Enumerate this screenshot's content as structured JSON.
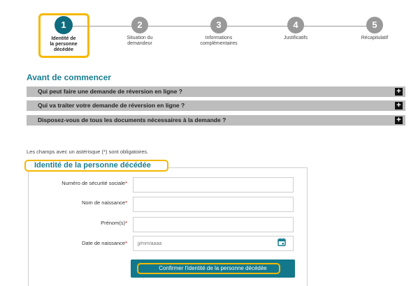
{
  "stepper": {
    "steps": [
      {
        "number": "1",
        "label_lines": [
          "Identité de",
          "la personne",
          "décédée"
        ],
        "active": true
      },
      {
        "number": "2",
        "label_lines": [
          "Situation du",
          "demandeur"
        ],
        "active": false
      },
      {
        "number": "3",
        "label_lines": [
          "Informations",
          "complémentaires"
        ],
        "active": false
      },
      {
        "number": "4",
        "label_lines": [
          "Justificatifs"
        ],
        "active": false
      },
      {
        "number": "5",
        "label_lines": [
          "Récapitulatif"
        ],
        "active": false
      }
    ]
  },
  "intro": {
    "title": "Avant de commencer",
    "accordions": [
      {
        "label": "Qui peut faire une demande de réversion en ligne ?",
        "icon": "plus-icon"
      },
      {
        "label": "Qui va traiter votre demande de réversion en ligne ?",
        "icon": "plus-icon"
      },
      {
        "label": "Disposez-vous de tous les documents nécessaires à la demande ?",
        "icon": "plus-icon"
      }
    ]
  },
  "form": {
    "required_note": "Les champs avec un astérisque (*) sont obligatoires.",
    "legend": "Identité de la personne décédée",
    "fields": [
      {
        "label": "Numéro de sécurité sociale",
        "required_mark": "*",
        "value": "",
        "placeholder": ""
      },
      {
        "label": "Nom de naissance",
        "required_mark": "*",
        "value": "",
        "placeholder": ""
      },
      {
        "label": "Prénom(s)",
        "required_mark": "*",
        "value": "",
        "placeholder": ""
      },
      {
        "label": "Date de naissance",
        "required_mark": "*",
        "value": "",
        "placeholder": "jj/mm/aaaa",
        "icon": "calendar-icon"
      }
    ],
    "submit_label": "Confirmer l'identité de la personne décédée"
  },
  "colors": {
    "accent": "#1a7f91",
    "button": "#13788c",
    "highlight": "#f5b800",
    "accordion_bg": "#bdbdbd"
  }
}
